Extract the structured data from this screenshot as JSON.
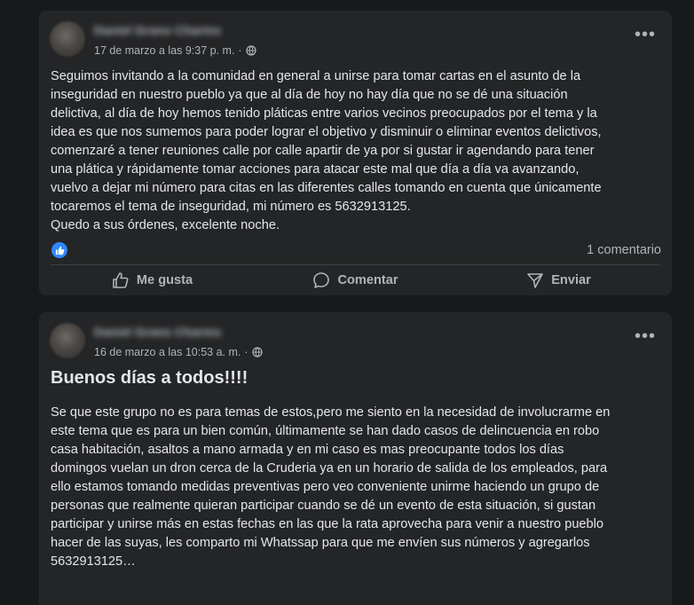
{
  "posts": [
    {
      "author": "Daniel Grano Charms",
      "timestamp": "17 de marzo a las 9:37 p. m.",
      "visibility_icon": "globe-icon",
      "text": "Seguimos invitando a la comunidad en general a unirse para tomar cartas en el asunto de la\ninseguridad en nuestro pueblo ya que al día de hoy no hay día que no se dé una situación\ndelictiva, al día de hoy hemos tenido pláticas entre varios vecinos preocupados por el tema y la\nidea es que nos sumemos para poder lograr el objetivo y disminuir o eliminar eventos delictivos,\ncomenzaré a tener reuniones calle por calle apartir de ya por si gustar ir agendando para tener\nuna plática y rápidamente tomar acciones para atacar este mal que día a día va avanzando,\nvuelvo a dejar mi número para citas en las diferentes calles tomando en cuenta que únicamente\ntocaremos el tema de inseguridad, mi número es 5632913125.\nQuedo a sus órdenes, excelente noche.",
      "comments": "1 comentario",
      "actions": {
        "like": "Me gusta",
        "comment": "Comentar",
        "send": "Enviar"
      }
    },
    {
      "author": "Daniel Grano Charms",
      "timestamp": "16 de marzo a las 10:53 a. m.",
      "visibility_icon": "globe-icon",
      "headline": "Buenos días a todos!!!!",
      "text": "Se que este grupo no es para temas de estos,pero me siento en la necesidad de involucrarme en\neste tema que es para un bien común, últimamente se han dado casos de delincuencia en robo\ncasa habitación, asaltos a mano armada y en mi caso es mas preocupante todos los días\ndomingos vuelan un dron cerca de la Cruderia ya en un horario de salida de los empleados, para\nello estamos tomando medidas preventivas pero veo conveniente unirme haciendo un grupo de\npersonas que realmente quieran participar cuando se dé un evento de esta situación, si gustan\nparticipar y unirse más en estas fechas en las que la rata aprovecha para venir a nuestro pueblo\nhacer de las suyas, les comparto mi Whatssap para que me envíen sus números y agregarlos\n5632913125…"
    }
  ],
  "colors": {
    "background": "#18191a",
    "card": "#242526",
    "text": "#e4e6eb",
    "secondary_text": "#b0b3b8",
    "like_blue": "#2d88ff"
  }
}
